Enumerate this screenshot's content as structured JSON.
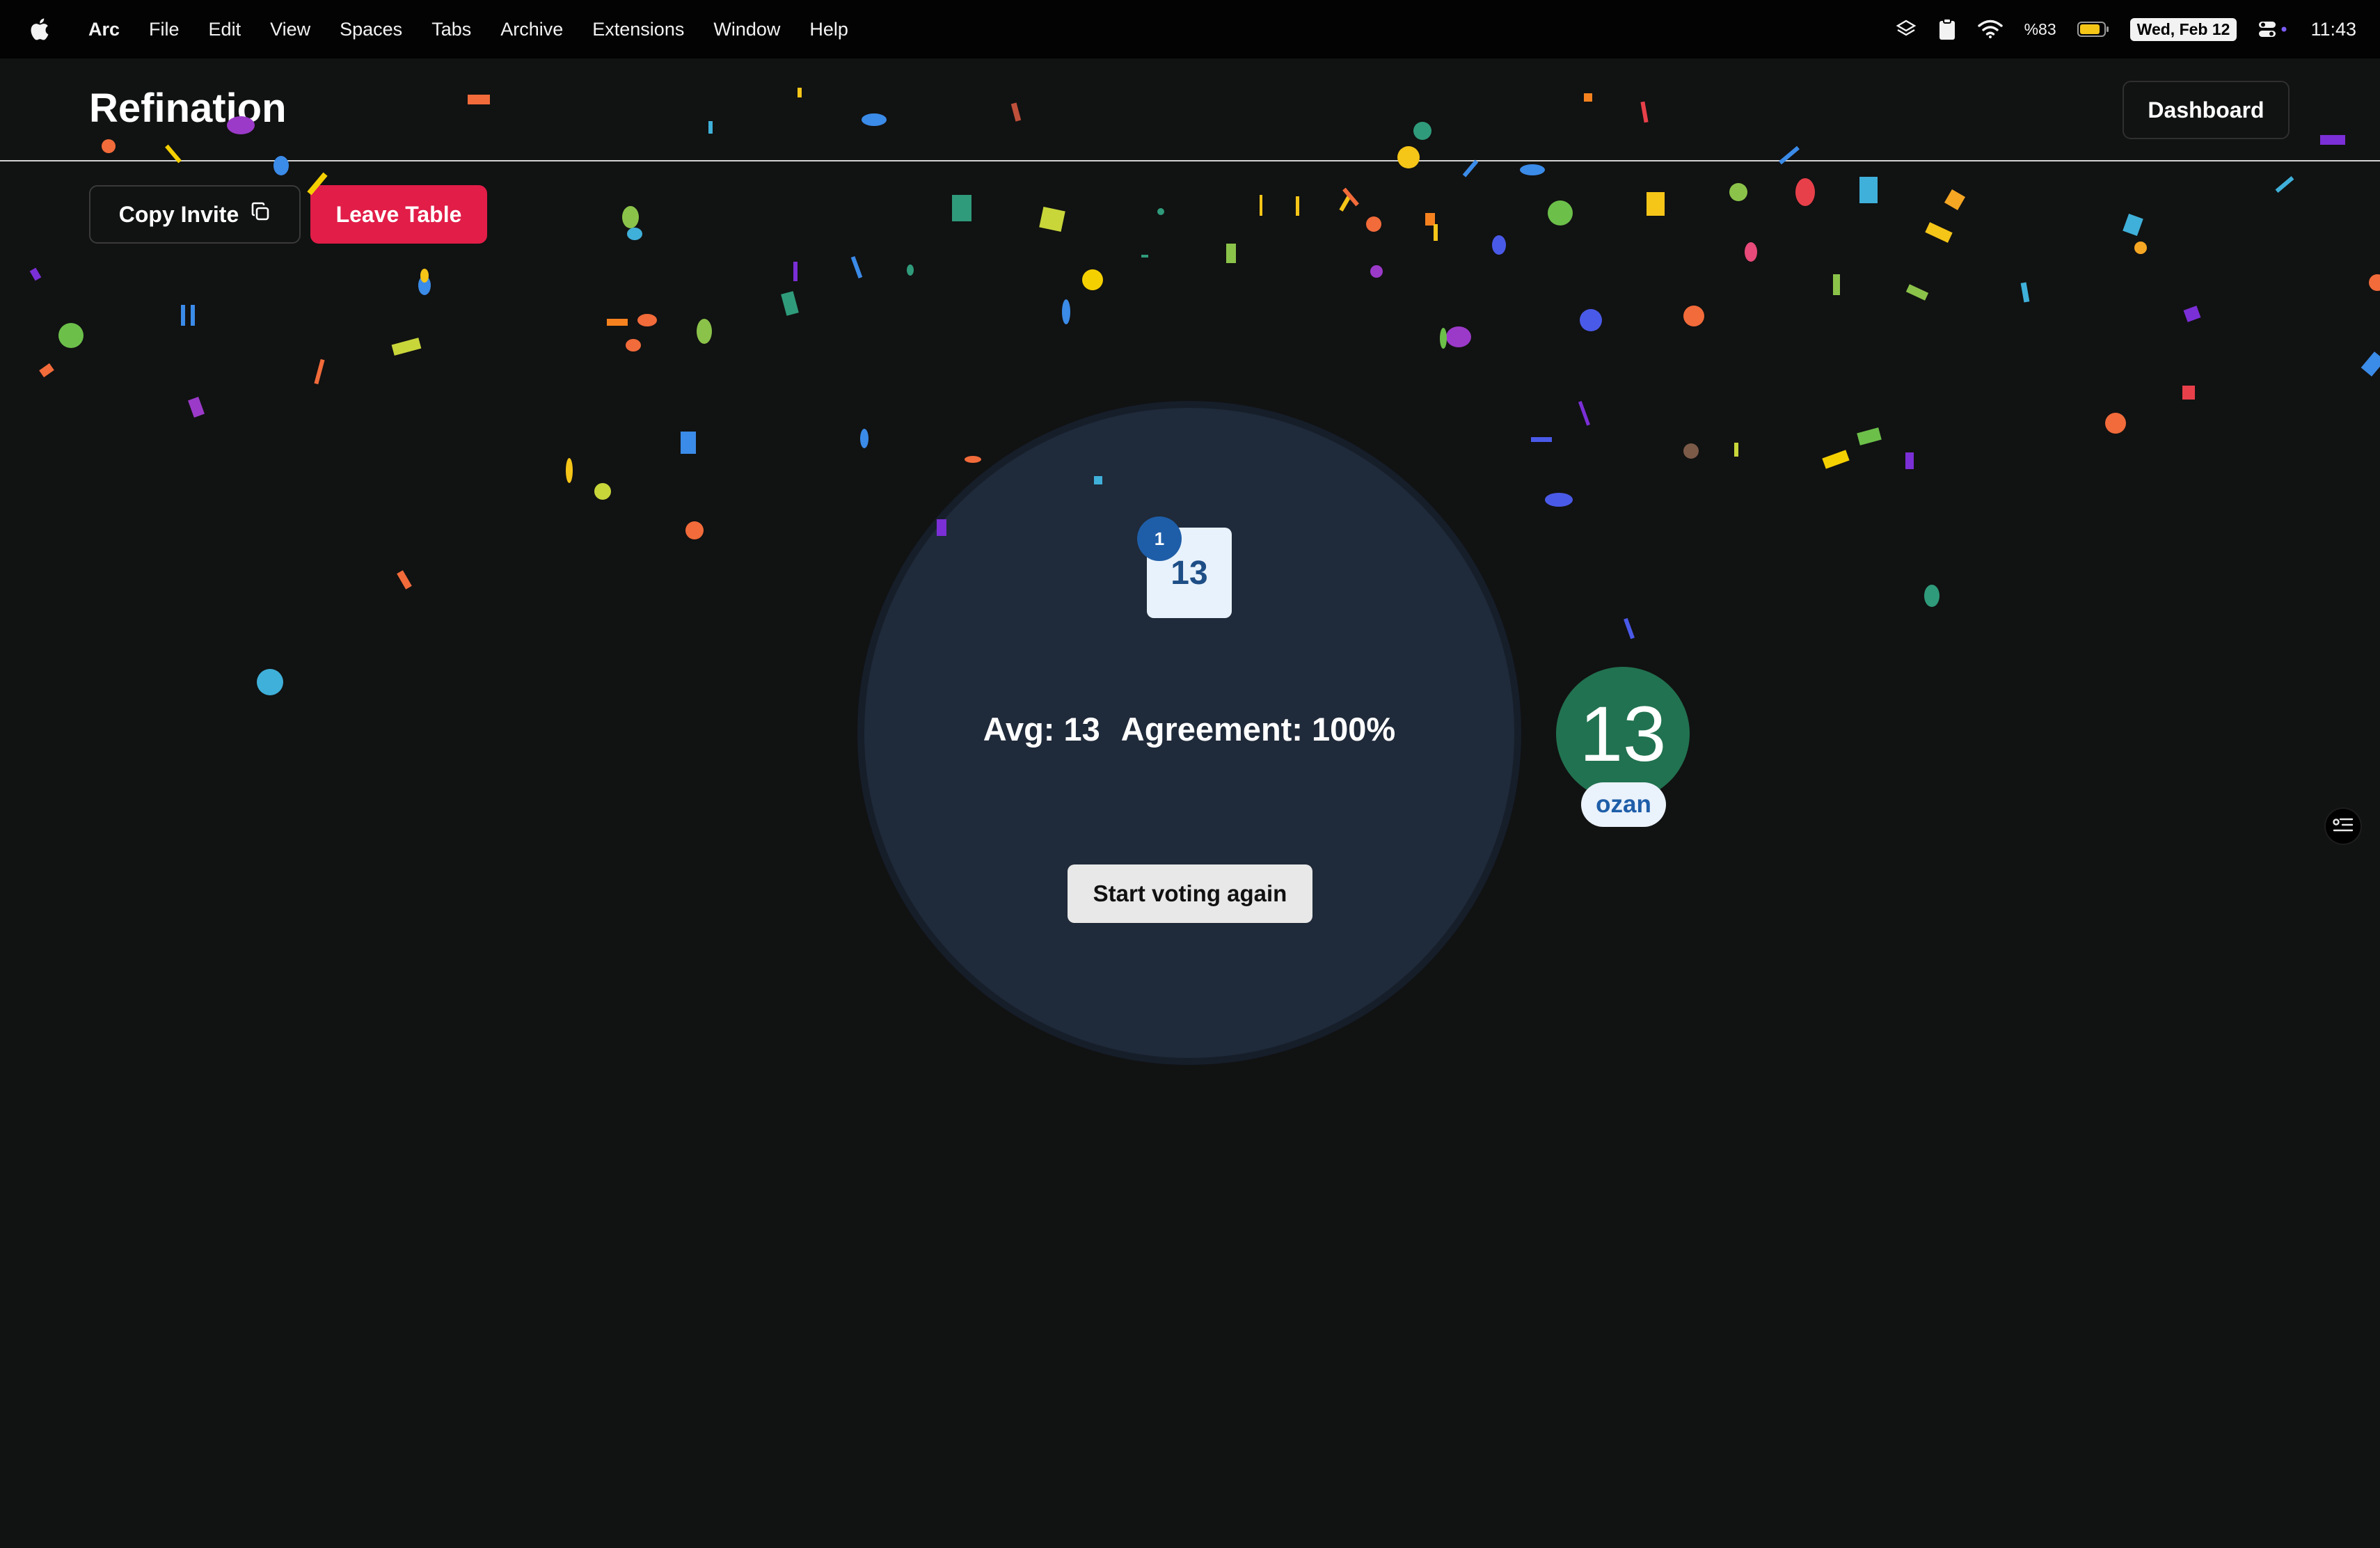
{
  "menubar": {
    "app_name": "Arc",
    "items": [
      "File",
      "Edit",
      "View",
      "Spaces",
      "Tabs",
      "Archive",
      "Extensions",
      "Window",
      "Help"
    ],
    "battery": "%83",
    "date": "Wed, Feb 12",
    "time": "11:43"
  },
  "header": {
    "brand": "Refination",
    "dashboard_label": "Dashboard"
  },
  "actions": {
    "copy_invite_label": "Copy Invite",
    "leave_table_label": "Leave Table"
  },
  "table": {
    "revealed_card_value": "13",
    "revealed_card_count": "1",
    "avg_text": "Avg: 13",
    "agreement_text": "Agreement: 100%",
    "restart_label": "Start voting again"
  },
  "players": [
    {
      "name": "ozan",
      "vote": "13"
    }
  ],
  "colors": {
    "background": "#111212",
    "table": "#1f2a3a",
    "leave_button": "#e11d48",
    "avatar": "#217250",
    "card_badge": "#1e5ea8"
  },
  "icons": {
    "apple": "apple-icon",
    "copy": "copy-icon",
    "layers": "layers-icon",
    "clipboard": "clipboard-icon",
    "wifi": "wifi-icon",
    "battery": "battery-icon",
    "control_center": "control-center-icon",
    "side_panel": "filter-list-icon"
  }
}
